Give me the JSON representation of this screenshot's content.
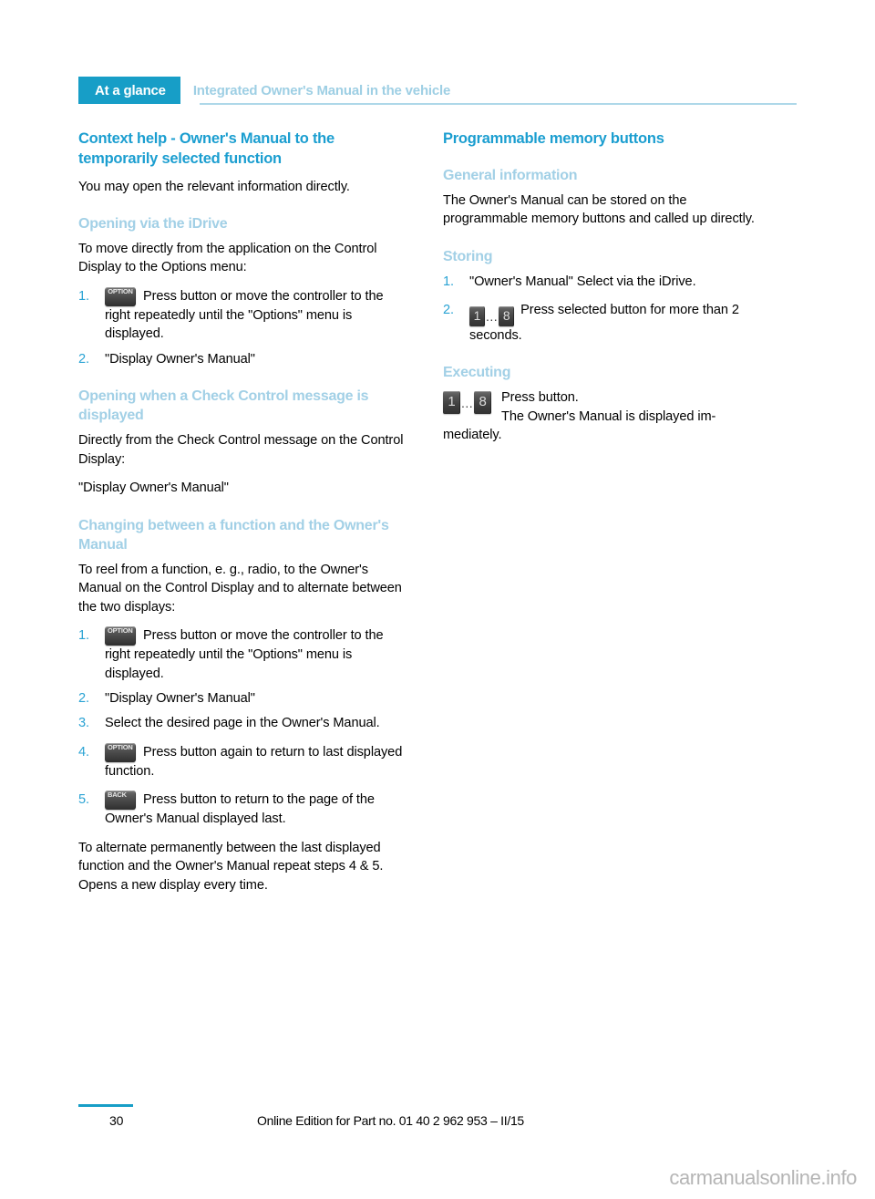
{
  "header": {
    "tab_label": "At a glance",
    "title": "Integrated Owner's Manual in the vehicle",
    "accent_color": "#179ec7",
    "title_color": "#9ecfe4"
  },
  "left_column": {
    "section_title": "Context help - Owner's Manual to the temporarily selected function",
    "intro": "You may open the relevant information directly.",
    "sub1": {
      "heading": "Opening via the iDrive",
      "lead": "To move directly from the application on the Control Display to the Options menu:",
      "steps": [
        {
          "num": "1.",
          "icon": "option-button-icon",
          "icon_label": "OPTION",
          "text": "Press button or move the controller to the right repeatedly until the \"Options\" menu is displayed."
        },
        {
          "num": "2.",
          "icon": null,
          "icon_label": null,
          "text": "\"Display Owner's Manual\""
        }
      ]
    },
    "sub2": {
      "heading": "Opening when a Check Control message is displayed",
      "lead": "Directly from the Check Control message on the Control Display:",
      "quote": "\"Display Owner's Manual\""
    },
    "sub3": {
      "heading": "Changing between a function and the Owner's Manual",
      "lead": "To reel from a function, e. g., radio, to the Owner's Manual on the Control Display and to alternate between the two displays:",
      "steps": [
        {
          "num": "1.",
          "icon": "option-button-icon",
          "icon_label": "OPTION",
          "text": "Press button or move the controller to the right repeatedly until the \"Options\" menu is displayed."
        },
        {
          "num": "2.",
          "icon": null,
          "icon_label": null,
          "text": "\"Display Owner's Manual\""
        },
        {
          "num": "3.",
          "icon": null,
          "icon_label": null,
          "text": "Select the desired page in the Owner's Manual."
        },
        {
          "num": "4.",
          "icon": "option-button-icon",
          "icon_label": "OPTION",
          "text": "Press button again to return to last displayed function."
        },
        {
          "num": "5.",
          "icon": "back-button-icon",
          "icon_label": "BACK",
          "text": "Press button to return to the page of the Owner's Manual displayed last."
        }
      ],
      "closing": "To alternate permanently between the last displayed function and the Owner's Manual repeat steps 4 & 5. Opens a new display every time."
    }
  },
  "right_column": {
    "section_title": "Programmable memory buttons",
    "sub1": {
      "heading": "General information",
      "text": "The Owner's Manual can be stored on the programmable memory buttons and called up directly."
    },
    "sub2": {
      "heading": "Storing",
      "steps": [
        {
          "num": "1.",
          "icon": null,
          "text": "\"Owner's Manual\" Select via the iDrive."
        },
        {
          "num": "2.",
          "icon": "memory-buttons-icon",
          "icon_from": "1",
          "icon_dots": "...",
          "icon_to": "8",
          "text": "Press selected button for more than 2 seconds."
        }
      ]
    },
    "sub3": {
      "heading": "Executing",
      "icon_from": "1",
      "icon_dots": "...",
      "icon_to": "8",
      "line1": "Press button.",
      "line2": "The Owner's Manual is displayed im-",
      "line3": "mediately."
    }
  },
  "footer": {
    "page_number": "30",
    "edition": "Online Edition for Part no. 01 40 2 962 953 – II/15",
    "watermark": "carmanualsonline.info"
  }
}
